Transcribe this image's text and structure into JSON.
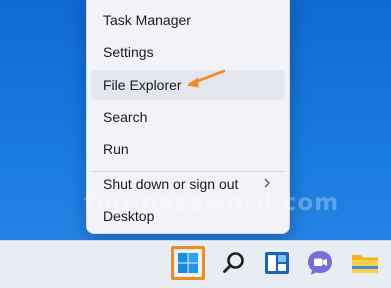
{
  "context_menu": {
    "items": [
      {
        "label": "Task Manager"
      },
      {
        "label": "Settings"
      },
      {
        "label": "File Explorer"
      },
      {
        "label": "Search"
      },
      {
        "label": "Run"
      },
      {
        "label": "Shut down or sign out"
      },
      {
        "label": "Desktop"
      }
    ],
    "highlighted_item": "File Explorer"
  },
  "watermark": "top-password.com",
  "taskbar": {
    "icons": [
      "windows-start-icon",
      "search-icon",
      "widgets-icon",
      "teams-chat-icon",
      "file-explorer-icon"
    ]
  },
  "colors": {
    "desktop_blue": "#1a7be0",
    "highlight_box": "#f28a1f",
    "annotation_arrow": "#f28a1f"
  }
}
